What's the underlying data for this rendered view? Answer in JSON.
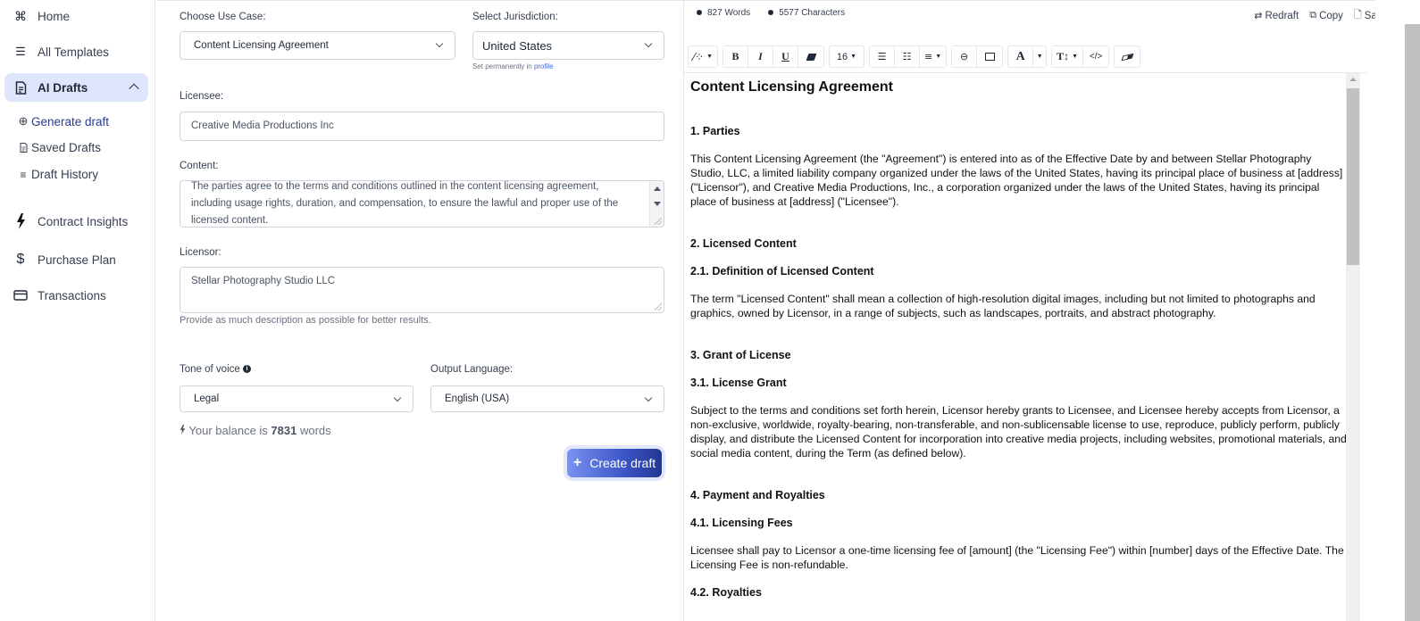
{
  "sidebar": {
    "items": [
      {
        "label": "Home",
        "icon": "command-icon"
      },
      {
        "label": "All Templates",
        "icon": "list-icon"
      },
      {
        "label": "AI Drafts",
        "icon": "document-icon",
        "expanded": true
      },
      {
        "label": "Contract Insights",
        "icon": "bolt-icon"
      },
      {
        "label": "Purchase Plan",
        "icon": "dollar-icon"
      },
      {
        "label": "Transactions",
        "icon": "credit-card-icon"
      }
    ],
    "sub_items": [
      {
        "label": "Generate draft",
        "icon": "plus-circle-icon",
        "current": true
      },
      {
        "label": "Saved Drafts",
        "icon": "file-icon"
      },
      {
        "label": "Draft History",
        "icon": "menu-icon"
      }
    ]
  },
  "form": {
    "use_case_label": "Choose Use Case:",
    "use_case_value": "Content Licensing Agreement",
    "jurisdiction_label": "Select Jurisdiction:",
    "jurisdiction_value": "United States",
    "jurisdiction_hint": "Set permanently in ",
    "jurisdiction_hint_link": "profile",
    "licensee_label": "Licensee:",
    "licensee_value": "Creative Media Productions Inc",
    "content_label": "Content:",
    "content_value": "The parties agree to the terms and conditions outlined in the content licensing agreement, including usage rights, duration, and compensation, to ensure the lawful and proper use of the licensed content.",
    "licensor_label": "Licensor:",
    "licensor_value": "Stellar Photography Studio LLC",
    "description_hint": "Provide as much description as possible for better results.",
    "tone_label": "Tone of voice",
    "tone_value": "Legal",
    "language_label": "Output Language:",
    "language_value": "English (USA)",
    "balance_prefix": "Your balance is ",
    "balance_value": "7831",
    "balance_suffix": " words",
    "create_button": "Create draft"
  },
  "editor": {
    "word_count": "827 Words",
    "char_count": "5577 Characters",
    "actions": {
      "redraft": "Redraft",
      "copy": "Copy",
      "save": "Save"
    },
    "toolbar": {
      "font_size": "16"
    },
    "document": {
      "title": "Content Licensing Agreement",
      "s1_heading": "1. Parties",
      "s1_text": "This Content Licensing Agreement (the \"Agreement\") is entered into as of the Effective Date by and between Stellar Photography Studio, LLC, a limited liability company organized under the laws of the United States, having its principal place of business at [address] (\"Licensor\"), and Creative Media Productions, Inc., a corporation organized under the laws of the United States, having its principal place of business at [address] (\"Licensee\").",
      "s2_heading": "2. Licensed Content",
      "s2_1_heading": "2.1. Definition of Licensed Content",
      "s2_1_text": "The term \"Licensed Content\" shall mean a collection of high-resolution digital images, including but not limited to photographs and graphics, owned by Licensor, in a range of subjects, such as landscapes, portraits, and abstract photography.",
      "s3_heading": "3. Grant of License",
      "s3_1_heading": "3.1. License Grant",
      "s3_1_text": "Subject to the terms and conditions set forth herein, Licensor hereby grants to Licensee, and Licensee hereby accepts from Licensor, a non-exclusive, worldwide, royalty-bearing, non-transferable, and non-sublicensable license to use, reproduce, publicly perform, publicly display, and distribute the Licensed Content for incorporation into creative media projects, including websites, promotional materials, and social media content, during the Term (as defined below).",
      "s4_heading": "4. Payment and Royalties",
      "s4_1_heading": "4.1. Licensing Fees",
      "s4_1_text": "Licensee shall pay to Licensor a one-time licensing fee of [amount] (the \"Licensing Fee\") within [number] days of the Effective Date. The Licensing Fee is non-refundable.",
      "s4_2_heading": "4.2. Royalties"
    }
  }
}
